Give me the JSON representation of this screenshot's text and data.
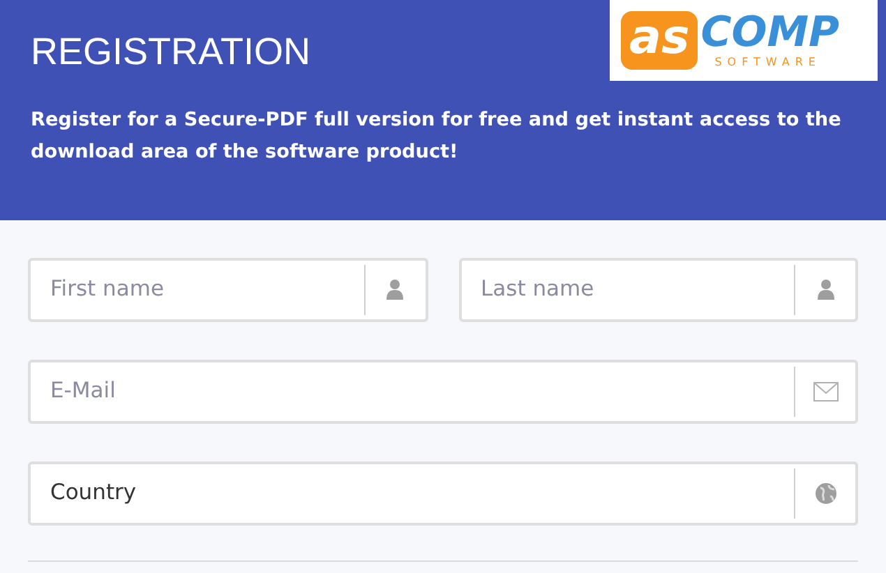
{
  "header": {
    "title": "REGISTRATION",
    "description": "Register for a Secure-PDF full version for free and get instant access to the download area of the software product!",
    "logo": {
      "mark": "as",
      "name": "COMP",
      "tagline": "SOFTWARE"
    }
  },
  "rows": [
    [
      {
        "kind": "name",
        "placeholder": "First name"
      },
      {
        "kind": "name",
        "placeholder": "Last name"
      }
    ],
    [
      {
        "kind": "email",
        "placeholder": "E-Mail"
      }
    ],
    [
      {
        "kind": "country",
        "value": "Country"
      }
    ]
  ]
}
